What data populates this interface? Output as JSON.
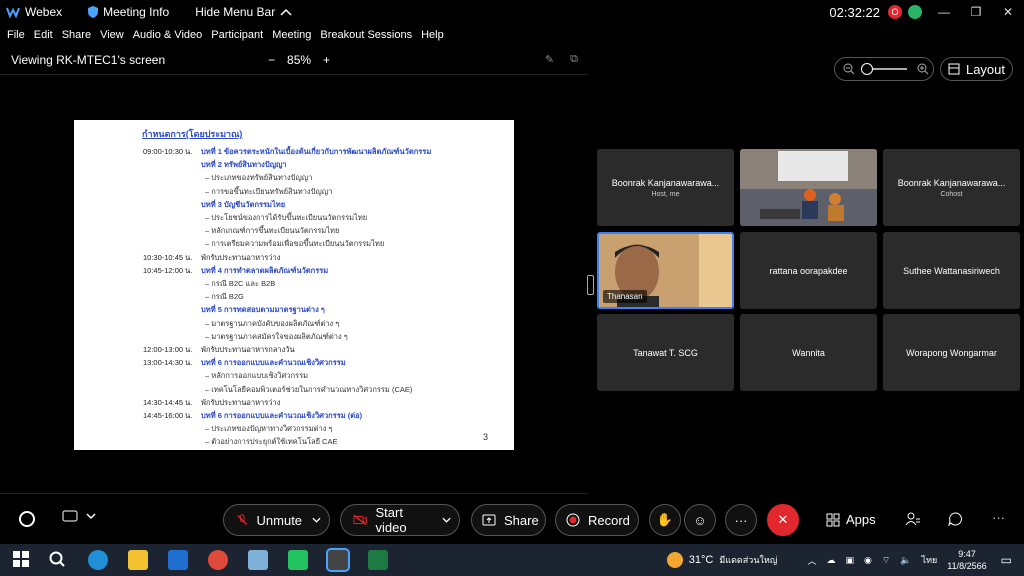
{
  "titlebar": {
    "app_name": "Webex",
    "meeting_info": "Meeting Info",
    "hide_menu": "Hide Menu Bar",
    "time": "02:32:22",
    "avatar_letter": "O"
  },
  "menu": [
    "File",
    "Edit",
    "Share",
    "View",
    "Audio & Video",
    "Participant",
    "Meeting",
    "Breakout Sessions",
    "Help"
  ],
  "viewbar": {
    "title": "Viewing RK-MTEC1's screen",
    "zoom": "85%",
    "minus": "−",
    "plus": "+"
  },
  "slide": {
    "heading": "กำหนดการ(โดยประมาณ)",
    "rows": [
      {
        "time": "09:00-10:30 น.",
        "text": "บทที่ 1 ข้อควรตระหนักในเบื้องต้นเกี่ยวกับการพัฒนาผลิตภัณฑ์นวัตกรรม",
        "style": "blue"
      },
      {
        "time": "",
        "text": "บทที่ 2 ทรัพย์สินทางปัญญา",
        "style": "blue"
      },
      {
        "time": "",
        "text": "– ประเภทของทรัพย์สินทางปัญญา",
        "style": "sub"
      },
      {
        "time": "",
        "text": "– การขอขึ้นทะเบียนทรัพย์สินทางปัญญา",
        "style": "sub"
      },
      {
        "time": "",
        "text": "บทที่ 3 บัญชีนวัตกรรมไทย",
        "style": "blue"
      },
      {
        "time": "",
        "text": "– ประโยชน์ของการได้รับขึ้นทะเบียนนวัตกรรมไทย",
        "style": "sub"
      },
      {
        "time": "",
        "text": "– หลักเกณฑ์การขึ้นทะเบียนนวัตกรรมไทย",
        "style": "sub"
      },
      {
        "time": "",
        "text": "– การเตรียมความพร้อมเพื่อขอขึ้นทะเบียนนวัตกรรมไทย",
        "style": "sub"
      },
      {
        "time": "10:30-10:45 น.",
        "text": "พักรับประทานอาหารว่าง",
        "style": "plain"
      },
      {
        "time": "10:45-12:00 น.",
        "text": "บทที่ 4 การทำตลาดผลิตภัณฑ์นวัตกรรม",
        "style": "blue"
      },
      {
        "time": "",
        "text": "– กรณี B2C และ B2B",
        "style": "sub"
      },
      {
        "time": "",
        "text": "– กรณี B2G",
        "style": "sub"
      },
      {
        "time": "",
        "text": "บทที่ 5 การทดสอบตามมาตรฐานต่าง ๆ",
        "style": "blue"
      },
      {
        "time": "",
        "text": "– มาตรฐานภาคบังคับของผลิตภัณฑ์ต่าง ๆ",
        "style": "sub"
      },
      {
        "time": "",
        "text": "– มาตรฐานภาคสมัครใจของผลิตภัณฑ์ต่าง ๆ",
        "style": "sub"
      },
      {
        "time": "12:00-13:00 น.",
        "text": "พักรับประทานอาหารกลางวัน",
        "style": "plain"
      },
      {
        "time": "13:00-14:30 น.",
        "text": "บทที่ 6 การออกแบบและคำนวณเชิงวิศวกรรม",
        "style": "blue"
      },
      {
        "time": "",
        "text": "– หลักการออกแบบเชิงวิศวกรรม",
        "style": "sub"
      },
      {
        "time": "",
        "text": "– เทคโนโลยีคอมพิวเตอร์ช่วยในการคำนวณทางวิศวกรรม (CAE)",
        "style": "sub"
      },
      {
        "time": "14:30-14:45 น.",
        "text": "พักรับประทานอาหารว่าง",
        "style": "plain"
      },
      {
        "time": "14:45-16:00 น.",
        "text": "บทที่ 6 การออกแบบและคำนวณเชิงวิศวกรรม (ต่อ)",
        "style": "blue"
      },
      {
        "time": "",
        "text": "– ประเภทของปัญหาทางวิศวกรรมต่าง ๆ",
        "style": "sub"
      },
      {
        "time": "",
        "text": "– ตัวอย่างการประยุกต์ใช้เทคโนโลยี CAE",
        "style": "sub"
      }
    ],
    "page_number": "3"
  },
  "right_pane": {
    "layout_label": "Layout"
  },
  "participants": [
    {
      "name": "Boonrak Kanjanawarawa...",
      "role": "Host, me",
      "kind": "name"
    },
    {
      "name": "",
      "role": "",
      "kind": "video-room"
    },
    {
      "name": "Boonrak Kanjanawarawa...",
      "role": "Cohost",
      "kind": "name"
    },
    {
      "name": "Thanasan",
      "role": "",
      "kind": "video-active"
    },
    {
      "name": "rattana oorapakdee",
      "role": "",
      "kind": "name"
    },
    {
      "name": "Suthee Wattanasiriwech",
      "role": "",
      "kind": "name"
    },
    {
      "name": "Tanawat T. SCG",
      "role": "",
      "kind": "name"
    },
    {
      "name": "Wannita",
      "role": "",
      "kind": "name"
    },
    {
      "name": "Worapong Wongarmar",
      "role": "",
      "kind": "name"
    }
  ],
  "controls": {
    "unmute": "Unmute",
    "start_video": "Start video",
    "share": "Share",
    "record": "Record",
    "apps": "Apps",
    "more": "···",
    "end": "✕"
  },
  "taskbar": {
    "weather_temp": "31°C",
    "weather_desc": "มีแดดส่วนใหญ่",
    "lang": "ไทย",
    "clock_time": "9:47",
    "clock_date": "11/8/2566"
  },
  "colors": {
    "accent_blue": "#3b82f6",
    "end_red": "#e0282e",
    "slide_blue": "#2d4bc9",
    "taskbar_bg": "#1c2431"
  }
}
